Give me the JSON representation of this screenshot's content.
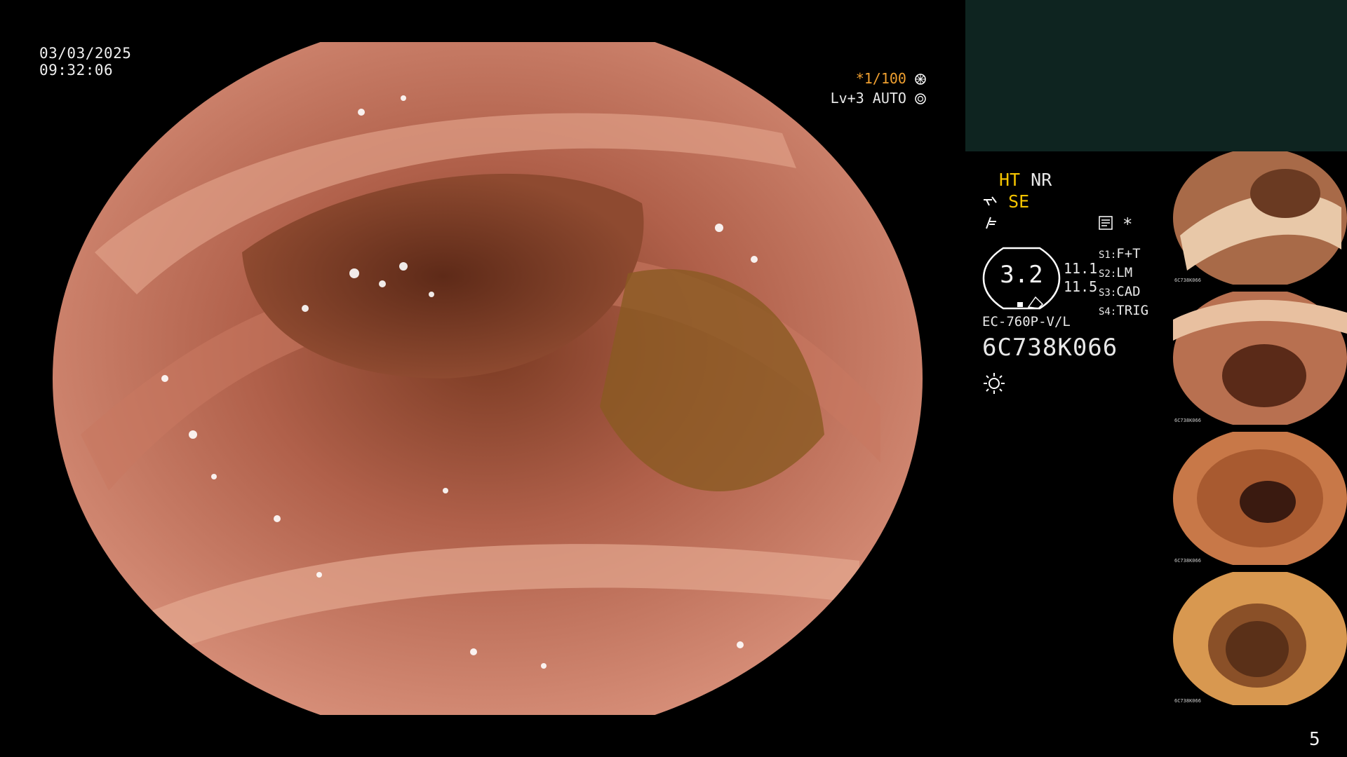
{
  "overlay": {
    "date": "03/03/2025",
    "time": "09:32:06",
    "shutter": "*1/100",
    "level": "Lv+3 AUTO"
  },
  "status": {
    "ht": "HT",
    "nr": "NR",
    "se": "SE",
    "gauge_value": "3.2",
    "val_1": "11.1",
    "val_2": "11.5",
    "slots": [
      {
        "key": "S1:",
        "value": "F+T"
      },
      {
        "key": "S2:",
        "value": "LM"
      },
      {
        "key": "S3:",
        "value": "CAD"
      },
      {
        "key": "S4:",
        "value": "TRIG"
      }
    ],
    "asterisk": "*",
    "model": "EC-760P-V/L",
    "serial": "6C738K066"
  },
  "thumbnails": [
    {
      "label": "6C738K066"
    },
    {
      "label": "6C738K066"
    },
    {
      "label": "6C738K066"
    },
    {
      "label": "6C738K066"
    }
  ],
  "page_number": "5",
  "icons": [
    "shutter-icon",
    "auto-icon",
    "pump-icon",
    "function-icon",
    "settings-icon",
    "brightness-icon"
  ],
  "colors": {
    "accent_orange": "#f0a030",
    "accent_yellow": "#f5c400",
    "panel": "#0e2420",
    "tissue": "#b8684a"
  }
}
